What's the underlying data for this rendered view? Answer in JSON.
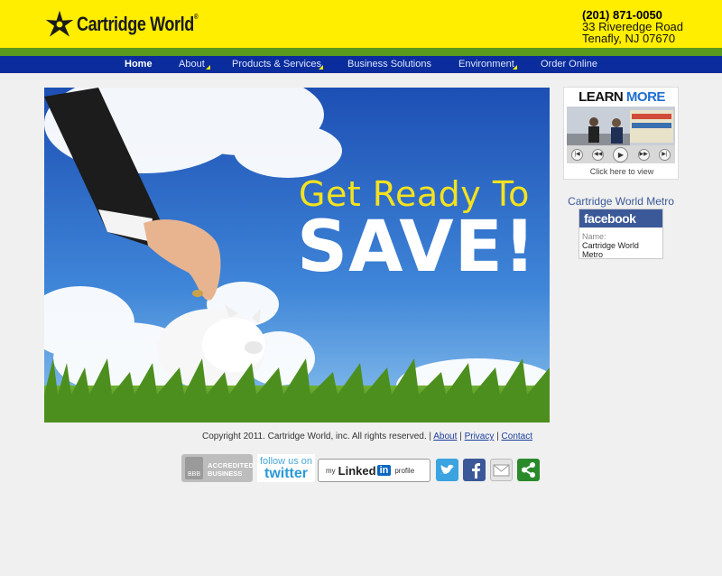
{
  "brand": {
    "name": "Cartridge World",
    "reg": "®"
  },
  "contact": {
    "phone": "(201) 871-0050",
    "street": "33 Riveredge Road",
    "city": "Tenafly, NJ 07670"
  },
  "nav": {
    "items": [
      {
        "label": "Home",
        "active": true,
        "dropdown": false
      },
      {
        "label": "About",
        "active": false,
        "dropdown": true
      },
      {
        "label": "Products & Services",
        "active": false,
        "dropdown": true
      },
      {
        "label": "Business Solutions",
        "active": false,
        "dropdown": false
      },
      {
        "label": "Environment",
        "active": false,
        "dropdown": true
      },
      {
        "label": "Order Online",
        "active": false,
        "dropdown": false
      }
    ]
  },
  "hero": {
    "line1": "Get Ready To",
    "line2": "SAVE!"
  },
  "sidebar": {
    "learn_more": {
      "title_learn": "LEARN",
      "title_more": "MORE",
      "caption": "Click here to view"
    },
    "facebook": {
      "title": "Cartridge World Metro",
      "brand": "facebook",
      "name_label": "Name:",
      "name_line1": "Cartridge World",
      "name_line2": "Metro"
    }
  },
  "footer": {
    "copyright": "Copyright 2011. Cartridge World, inc. All rights reserved. |",
    "links": {
      "about": "About",
      "privacy": "Privacy",
      "contact": "Contact"
    },
    "separator": "|"
  },
  "social": {
    "bbb": {
      "line1": "ACCREDITED",
      "line2": "BUSINESS",
      "mark": "BBB"
    },
    "twitter_follow": {
      "line1": "follow us on",
      "line2": "twitter"
    },
    "linkedin": {
      "prefix": "my",
      "brand": "Linked",
      "in": "in",
      "suffix": "profile"
    }
  },
  "colors": {
    "header_yellow": "#ffee00",
    "nav_blue": "#0a2c9c",
    "green_stripe": "#5a9a1e",
    "facebook_blue": "#3b5998"
  }
}
